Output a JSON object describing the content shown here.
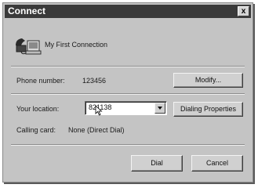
{
  "window": {
    "title": "Connect",
    "close_glyph": "x"
  },
  "connection": {
    "icon": "dialup-connection-icon",
    "name": "My First Connection"
  },
  "phone": {
    "label": "Phone number:",
    "value": "123456",
    "modify_button": "Modify..."
  },
  "location": {
    "label": "Your location:",
    "value": "821138",
    "dialing_properties_button": "Dialing Properties"
  },
  "calling_card": {
    "label": "Calling card:",
    "value": "None (Direct Dial)"
  },
  "actions": {
    "dial_button": "Dial",
    "cancel_button": "Cancel"
  },
  "colors": {
    "titlebar": "#3a3a3a",
    "dialog_face": "#c4c4c4"
  }
}
